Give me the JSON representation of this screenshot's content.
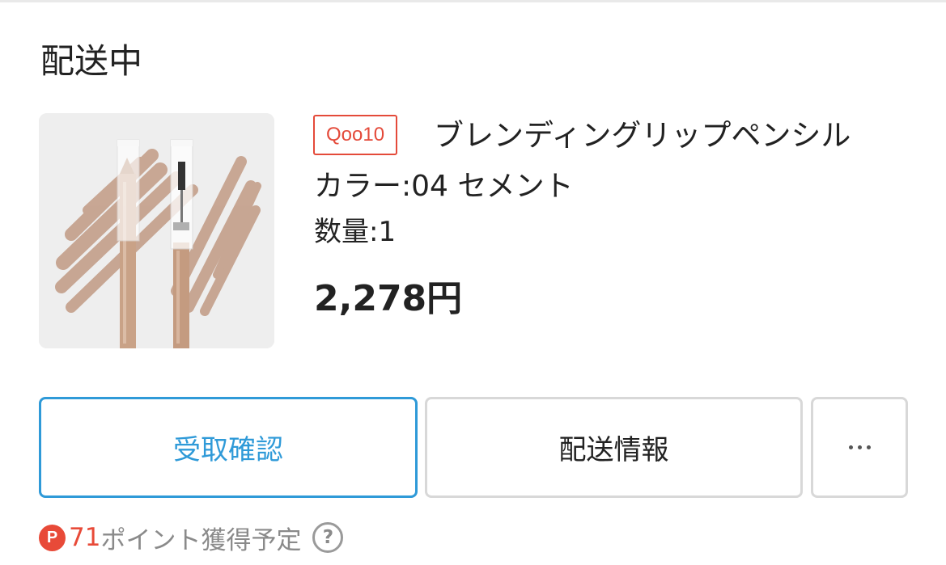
{
  "order": {
    "status": "配送中"
  },
  "product": {
    "shop_badge": "Qoo10",
    "name": "ブレンディングリップペンシル",
    "variant": "カラー:04 セメント",
    "quantity": "数量:1",
    "price": "2,278円"
  },
  "actions": {
    "confirm_receipt": "受取確認",
    "shipping_info": "配送情報",
    "more": "more-icon"
  },
  "points": {
    "icon_letter": "P",
    "amount": "71",
    "label": "ポイント獲得予定",
    "help": "?"
  },
  "colors": {
    "accent_blue": "#2f9ad8",
    "accent_red": "#e44a3a",
    "text": "#222222",
    "muted": "#8a8a8a"
  }
}
